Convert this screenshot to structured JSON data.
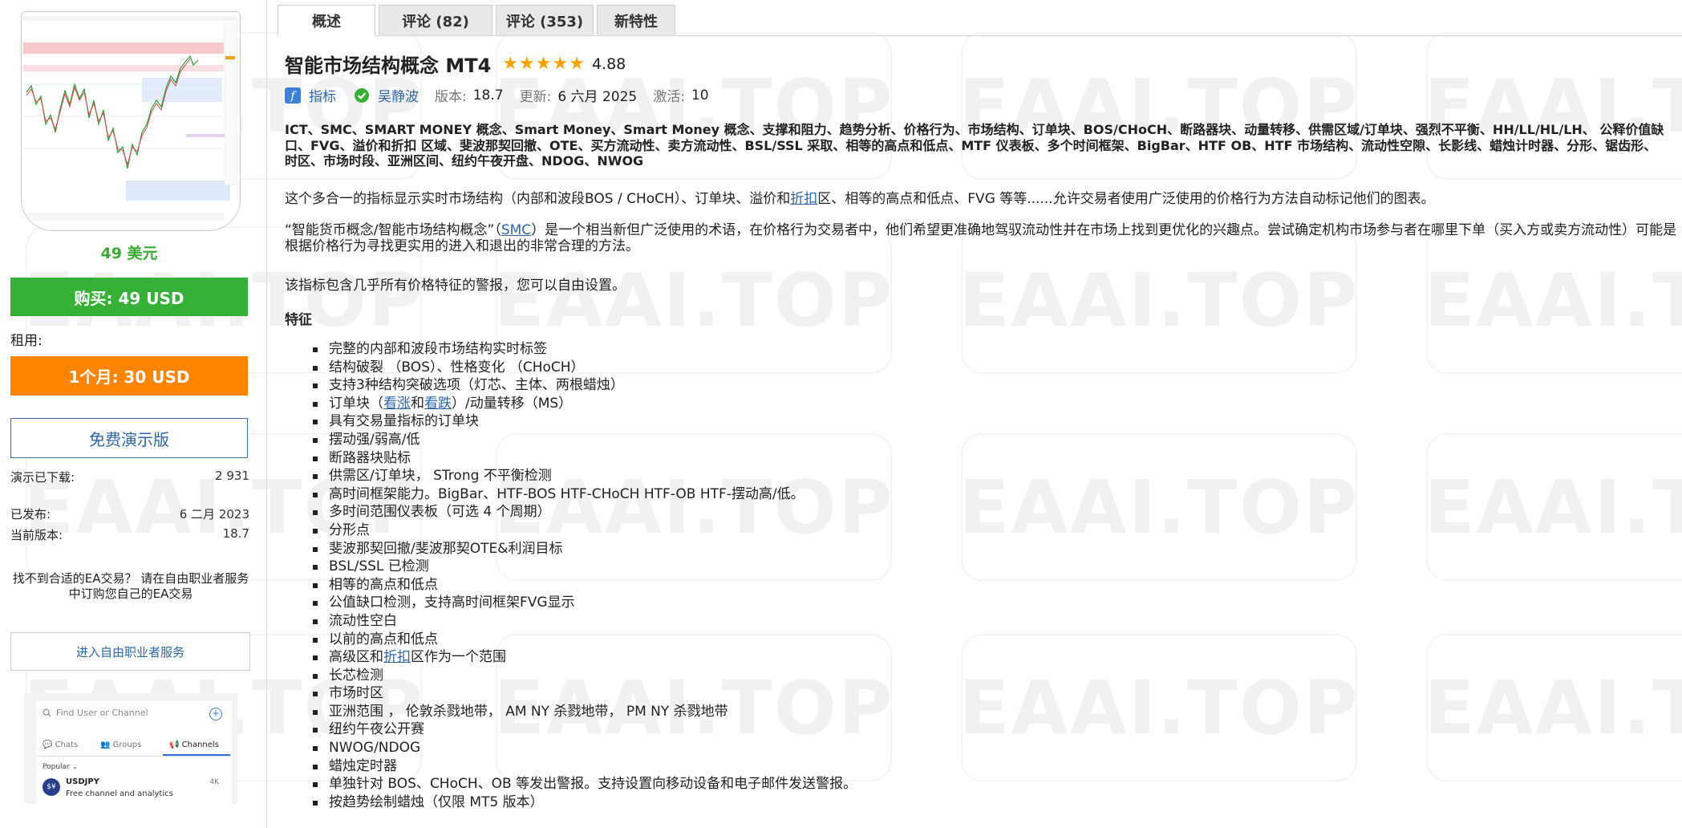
{
  "tabs": [
    {
      "label": "概述",
      "active": true
    },
    {
      "label": "评论 (82)"
    },
    {
      "label": "评论 (353)"
    },
    {
      "label": "新特性"
    }
  ],
  "sidebar": {
    "price": "49 美元",
    "buy_label": "购买: 49 USD",
    "rent_label": "租用:",
    "rent_button": "1个月: 30 USD",
    "demo_button": "免费演示版",
    "stats": [
      {
        "label": "演示已下载:",
        "value": "2 931"
      },
      {
        "label": "已发布:",
        "value": "6 二月 2023"
      },
      {
        "label": "当前版本:",
        "value": "18.7"
      }
    ],
    "freelance_text": "找不到合适的EA交易？ 请在自由职业者服务中订购您自己的EA交易",
    "freelance_button": "进入自由职业者服务",
    "ad": {
      "search_placeholder": "Find User or Channel",
      "tab_chats": "Chats",
      "tab_groups": "Groups",
      "tab_channels": "Channels",
      "popular": "Popular",
      "channel_name": "USDJPY",
      "channel_desc": "Free channel and analytics",
      "channel_count": "4K",
      "avatar_text": "$¥"
    }
  },
  "product": {
    "title": "智能市场结构概念 MT4",
    "stars": "★★★★★",
    "rating": "4.88",
    "category": "指标",
    "author": "吴静波",
    "version_label": "版本:",
    "version": "18.7",
    "updated_label": "更新:",
    "updated": "6 六月 2025",
    "activations_label": "激活:",
    "activations": "10"
  },
  "keywords": "ICT、SMC、SMART MONEY 概念、Smart Money、Smart Money 概念、支撑和阻力、趋势分析、价格行为、市场结构、订单块、BOS/CHoCH、断路器块、动量转移、供需区域/订单块、强烈不平衡、HH/LL/HL/LH、 公释价值缺口、FVG、溢价和折扣 区域、斐波那契回撤、OTE、买方流动性、卖方流动性、BSL/SSL 采取、相等的高点和低点、MTF 仪表板、多个时间框架、BigBar、HTF OB、HTF 市场结构、流动性空隙、长影线、蜡烛计时器、分形、锯齿形、时区、市场时段、亚洲区间、纽约午夜开盘、NDOG、NWOG",
  "para1": {
    "pre": "这个多合一的指标显示实时市场结构（内部和波段BOS / CHoCH）、订单块、溢价和",
    "link": "折扣",
    "post": "区、相等的高点和低点、FVG 等等......允许交易者使用广泛使用的价格行为方法自动标记他们的图表。"
  },
  "para2": {
    "pre": "“智能货币概念/智能市场结构概念”（",
    "link": "SMC",
    "post": "）是一个相当新但广泛使用的术语，在价格行为交易者中，他们希望更准确地驾驭流动性并在市场上找到更优化的兴趣点。尝试确定机构市场参与者在哪里下单（买入方或卖方流动性）可能是根据价格行为寻找更实用的进入和退出的非常合理的方法。"
  },
  "para3": "该指标包含几乎所有价格特征的警报，您可以自由设置。",
  "features_title": "特征",
  "features": [
    "完整的内部和波段市场结构实时标签",
    "结构破裂 （BOS）、性格变化 （CHoCH）",
    "支持3种结构突破选项（灯芯、主体、两根蜡烛）",
    "订单块（看涨和看跌）/动量转移（MS）",
    "具有交易量指标的订单块",
    "摆动强/弱高/低",
    "断路器块贴标",
    "供需区/订单块， STrong 不平衡检测",
    "高时间框架能力。BigBar、HTF-BOS HTF-CHoCH HTF-OB HTF-摆动高/低。",
    "多时间范围仪表板（可选 4 个周期）",
    "分形点",
    "斐波那契回撤/斐波那契OTE&利润目标",
    "BSL/SSL 已检测",
    "相等的高点和低点",
    "公值缺口检测，支持高时间框架FVG显示",
    "流动性空白",
    "以前的高点和低点",
    "高级区和折扣区作为一个范围",
    "长芯检测",
    "市场时区",
    "亚洲范围 ， 伦敦杀戮地带， AM NY 杀戮地带， PM NY 杀戮地带",
    "纽约午夜公开赛",
    "NWOG/NDOG",
    "蜡烛定时器",
    "单独针对 BOS、CHoCH、OB 等发出警报。支持设置向移动设备和电子邮件发送警报。",
    "按趋势绘制蜡烛（仅限 MT5 版本）"
  ],
  "feature_links": {
    "bull": "看涨",
    "bear": "看跌",
    "discount": "折扣"
  },
  "watermark": "EAAI.TOP",
  "colors": {
    "buy": "#36b037",
    "rent": "#ff8500",
    "link": "#2e65ad",
    "star": "#f4a300",
    "price": "#3aa935"
  }
}
